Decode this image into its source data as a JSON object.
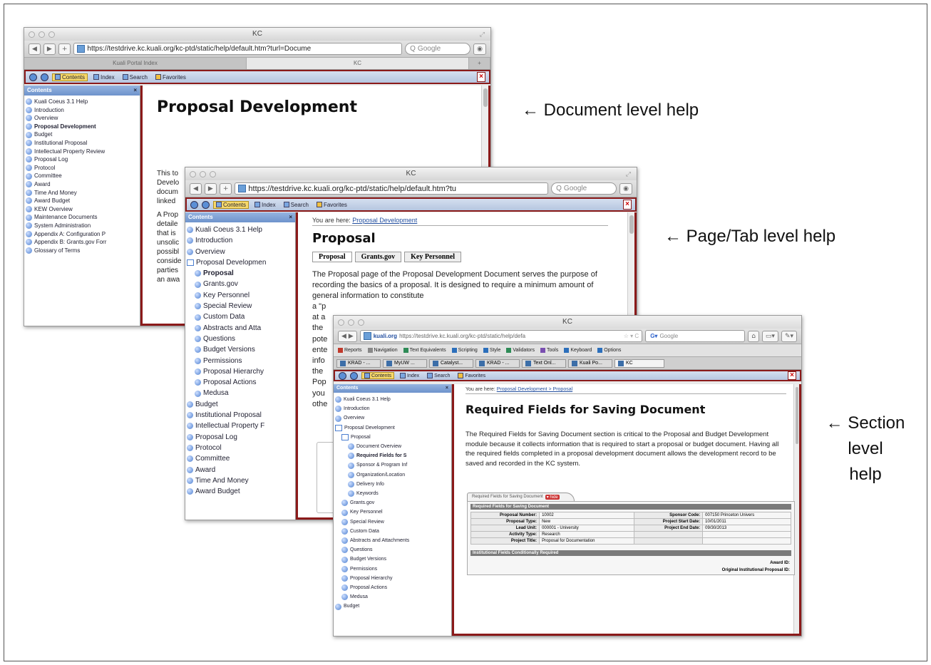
{
  "callouts": {
    "document": "← Document level help",
    "page_tab": "← Page/Tab level help",
    "section_l1": "← Section",
    "section_l2": "level",
    "section_l3": "help"
  },
  "win1": {
    "title": "KC",
    "url": "https://testdrive.kc.kuali.org/kc-ptd/static/help/default.htm?turl=Docume",
    "search": "Google",
    "tabs": [
      "Kuali Portal Index",
      "KC"
    ],
    "help_toolbar": {
      "contents": "Contents",
      "index": "Index",
      "search": "Search",
      "favorites": "Favorites"
    },
    "sidebar_title": "Contents",
    "sidebar": [
      "Kuali Coeus 3.1 Help",
      "Introduction",
      "Overview",
      "Proposal Development",
      "Budget",
      "Institutional Proposal",
      "Intellectual Property Review",
      "Proposal Log",
      "Protocol",
      "Committee",
      "Award",
      "Time And Money",
      "Award Budget",
      "KEW Overview",
      "Maintenance Documents",
      "System Administration",
      "Appendix A: Configuration P",
      "Appendix B: Grants.gov Forr",
      "Glossary of Terms"
    ],
    "heading": "Proposal Development",
    "peek_lines": [
      "This to",
      "Develo",
      "docum",
      "linked",
      "A Prop",
      "detaile",
      "that is",
      "unsolic",
      "possibl",
      "conside",
      "parties",
      "an awa"
    ]
  },
  "win2": {
    "title": "KC",
    "url": "https://testdrive.kc.kuali.org/kc-ptd/static/help/default.htm?tu",
    "search": "Google",
    "help_toolbar": {
      "contents": "Contents",
      "index": "Index",
      "search": "Search",
      "favorites": "Favorites"
    },
    "sidebar_title": "Contents",
    "sidebar": [
      "Kuali Coeus 3.1 Help",
      "Introduction",
      "Overview",
      "Proposal Developmen",
      "Proposal",
      "Grants.gov",
      "Key Personnel",
      "Special Review",
      "Custom Data",
      "Abstracts and Atta",
      "Questions",
      "Budget Versions",
      "Permissions",
      "Proposal Hierarchy",
      "Proposal Actions",
      "Medusa",
      "Budget",
      "Institutional Proposal",
      "Intellectual Property F",
      "Proposal Log",
      "Protocol",
      "Committee",
      "Award",
      "Time And Money",
      "Award Budget"
    ],
    "you_are_here": "You are here:",
    "crumb": "Proposal Development",
    "heading": "Proposal",
    "page_tabs": [
      "Proposal",
      "Grants.gov",
      "Key Personnel"
    ],
    "para": "The Proposal page of the Proposal Development Document serves the purpose of recording the basics of a proposal.  It is designed to require a minimum amount of general information to constitute",
    "peek_lines": [
      "a \"p",
      "at a",
      "the",
      "pote",
      "ente",
      "info",
      "the",
      "Pop",
      "you",
      "othe"
    ]
  },
  "win3": {
    "title": "KC",
    "site": "kuali.org",
    "url": "https://testdrive.kc.kuali.org/kc-ptd/static/help/defa",
    "search": "Google",
    "devbar": [
      "Reports",
      "Navigation",
      "Text Equivalents",
      "Scripting",
      "Style",
      "Validators",
      "Tools",
      "Keyboard",
      "Options"
    ],
    "tabs": [
      "KRAD - ...",
      "MyUW ...",
      "Catalyst...",
      "KRAD - ...",
      "Text Onl...",
      "Kuali Po...",
      "KC"
    ],
    "help_toolbar": {
      "contents": "Contents",
      "index": "Index",
      "search": "Search",
      "favorites": "Favorites"
    },
    "sidebar_title": "Contents",
    "sidebar": [
      "Kuali Coeus 3.1 Help",
      "Introduction",
      "Overview",
      "Proposal Development",
      "Proposal",
      "Document Overview",
      "Required Fields for S",
      "Sponsor & Program Inf",
      "Organization/Location",
      "Delivery Info",
      "Keywords",
      "Grants.gov",
      "Key Personnel",
      "Special Review",
      "Custom Data",
      "Abstracts and Attachments",
      "Questions",
      "Budget Versions",
      "Permissions",
      "Proposal Hierarchy",
      "Proposal Actions",
      "Medusa",
      "Budget"
    ],
    "you_are_here": "You are here:",
    "crumb": "Proposal Development > Proposal",
    "heading": "Required Fields for Saving Document",
    "para": "The Required Fields for Saving Document section is critical to the Proposal and Budget Development module because it collects information that is required to start a proposal or budget document.  Having all the required fields completed in a proposal development document allows the development record to be saved and recorded in the KC system.",
    "section_tab": "Required Fields for Saving Document",
    "hide": "▾ hide",
    "table_title": "Required Fields for Saving Document",
    "rows": [
      {
        "l1": "Proposal Number:",
        "v1": "10002",
        "l2": "Sponsor Code:",
        "v2": "007150 Princeton Univers"
      },
      {
        "l1": "Proposal Type:",
        "v1": "New",
        "l2": "Project Start Date:",
        "v2": "10/01/2011"
      },
      {
        "l1": "Lead Unit:",
        "v1": "000001 - University",
        "l2": "Project End Date:",
        "v2": "09/30/2013"
      },
      {
        "l1": "Activity Type:",
        "v1": "Research",
        "l2": "",
        "v2": ""
      },
      {
        "l1": "Project Title:",
        "v1": "Proposal for Documentation",
        "l2": "",
        "v2": ""
      }
    ],
    "section2_title": "Institutional Fields Conditionally Required",
    "award_id": "Award ID:",
    "orig_prop": "Original Institutional Proposal ID:"
  }
}
